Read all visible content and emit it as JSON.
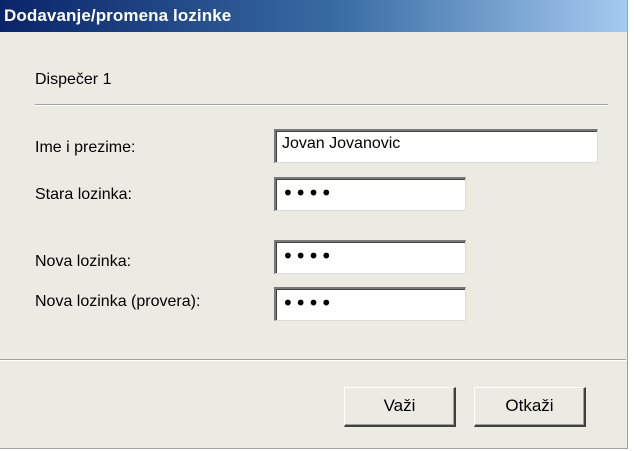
{
  "window": {
    "title": "Dodavanje/promena lozinke"
  },
  "header": {
    "subtitle": "Dispečer 1"
  },
  "form": {
    "full_name": {
      "label": "Ime i prezime:",
      "value": "Jovan Jovanovic"
    },
    "old_password": {
      "label": "Stara lozinka:",
      "value": "••••"
    },
    "new_password": {
      "label": "Nova lozinka:",
      "value": "••••"
    },
    "new_password_confirm": {
      "label": "Nova lozinka (provera):",
      "value": "••••"
    }
  },
  "buttons": {
    "ok_label": "Važi",
    "cancel_label": "Otkaži"
  },
  "colors": {
    "titlebar_start": "#0a246a",
    "titlebar_end": "#a6caf0",
    "dialog_background": "#ebebe4"
  }
}
